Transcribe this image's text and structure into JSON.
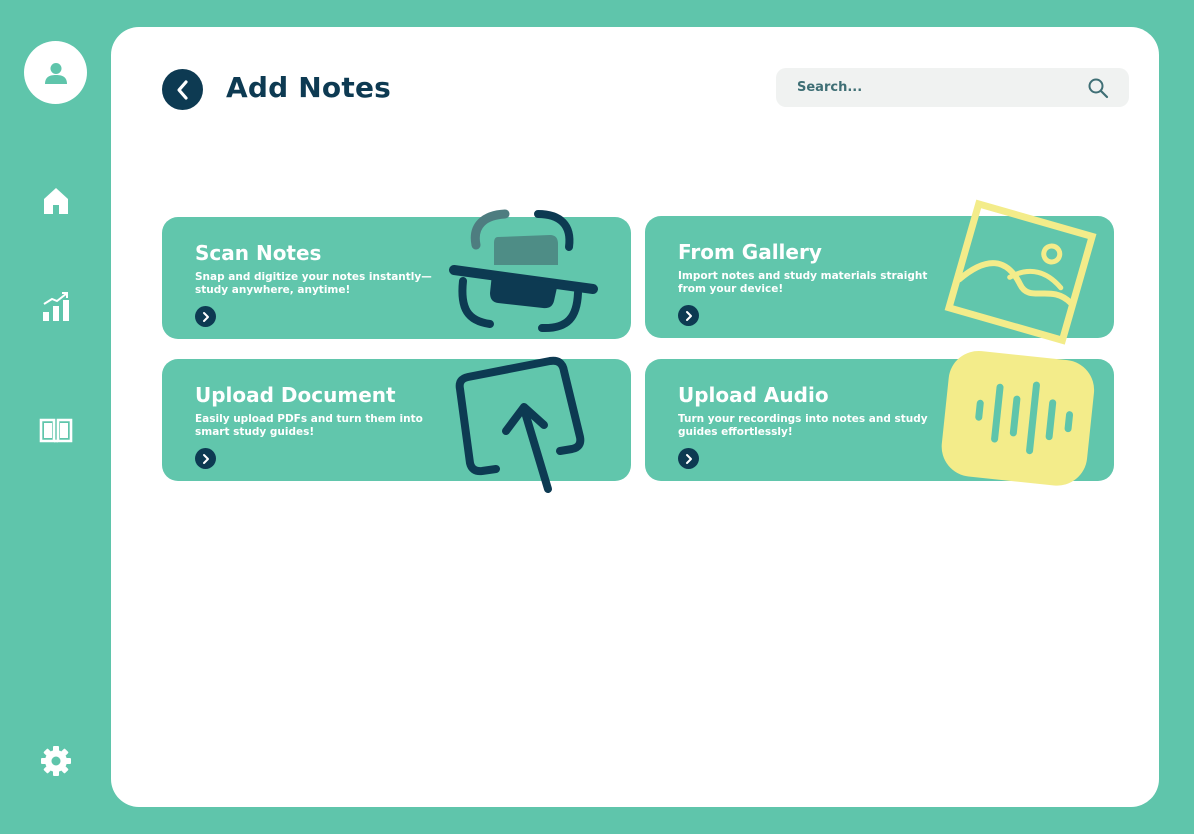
{
  "sidebar": {
    "items": [
      {
        "name": "profile",
        "icon": "user-icon"
      },
      {
        "name": "home",
        "icon": "home-icon"
      },
      {
        "name": "stats",
        "icon": "bar-chart-icon"
      },
      {
        "name": "library",
        "icon": "book-icon"
      },
      {
        "name": "settings",
        "icon": "gear-icon"
      }
    ]
  },
  "header": {
    "title": "Add Notes",
    "back_icon": "chevron-left-icon"
  },
  "search": {
    "placeholder": "Search...",
    "icon": "search-icon"
  },
  "cards": [
    {
      "title": "Scan Notes",
      "description": "Snap and digitize your notes instantly—study anywhere, anytime!",
      "icon": "scan-icon"
    },
    {
      "title": "From Gallery",
      "description": "Import notes and study materials straight from your device!",
      "icon": "image-icon"
    },
    {
      "title": "Upload Document",
      "description": "Easily upload PDFs and turn them into smart study guides!",
      "icon": "upload-icon"
    },
    {
      "title": "Upload Audio",
      "description": "Turn your recordings into notes and study guides effortlessly!",
      "icon": "audio-wave-icon"
    }
  ],
  "colors": {
    "background": "#5fc5ab",
    "card": "#61c6ac",
    "navy": "#0d3a52",
    "yellow": "#f3ec8a",
    "panel": "#ffffff"
  }
}
